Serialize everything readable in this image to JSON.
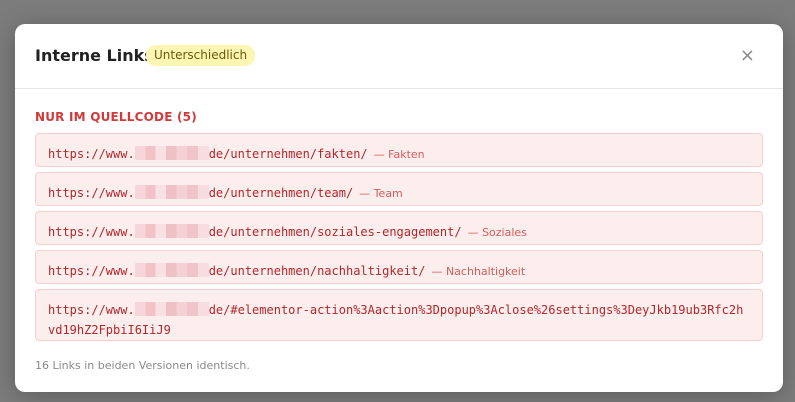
{
  "modal": {
    "title": "Interne Links",
    "badge": "Unterschiedlich",
    "close_symbol": "×"
  },
  "section": {
    "title": "NUR IM QUELLCODE (5)"
  },
  "links": [
    {
      "prefix": "https://www.",
      "suffix": "de/unternehmen/fakten/",
      "note": "— Fakten"
    },
    {
      "prefix": "https://www.",
      "suffix": "de/unternehmen/team/",
      "note": "— Team"
    },
    {
      "prefix": "https://www.",
      "suffix": "de/unternehmen/soziales-engagement/",
      "note": "— Soziales"
    },
    {
      "prefix": "https://www.",
      "suffix": "de/unternehmen/nachhaltigkeit/",
      "note": "— Nachhaltigkeit"
    },
    {
      "prefix": "https://www.",
      "suffix": "de/#elementor-action%3Aaction%3Dpopup%3Aclose%26settings%3DeyJkb19ub3Rfc2hvd19hZ2FpbiI6IiJ9",
      "note": ""
    }
  ],
  "footer": {
    "text": "16 Links in beiden Versionen identisch."
  }
}
